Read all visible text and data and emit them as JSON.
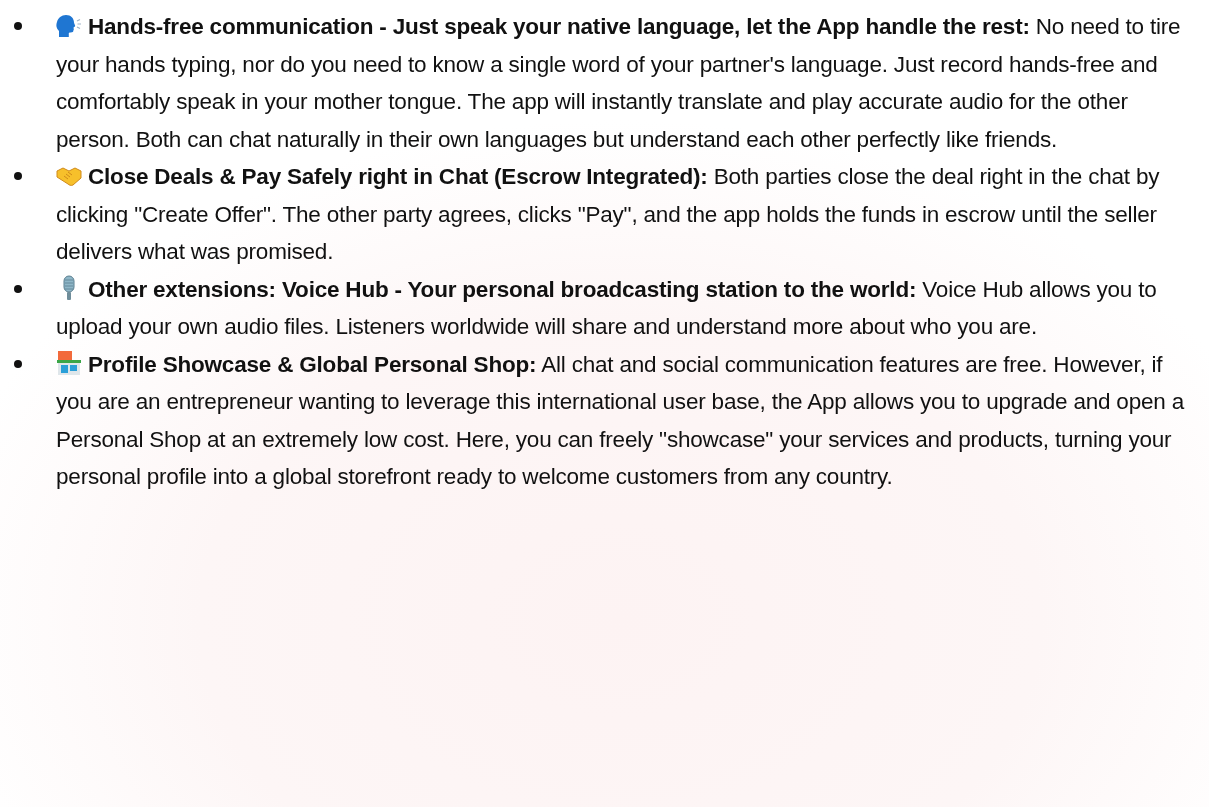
{
  "features": [
    {
      "kind": "speaking-head",
      "text": "**Hands-free communication - Just speak your native language, let the App handle the rest:** No need to tire your hands typing, nor do you need to know a single word of your partner's language. Just record hands-free and comfortably speak in your mother tongue. The app will instantly translate and play accurate audio for the other person. Both can chat naturally in their own languages but understand each other perfectly like friends."
    },
    {
      "kind": "handshake",
      "text": "**Close Deals & Pay Safely right in Chat (Escrow Integrated):** Both parties close the deal right in the chat by clicking \"Create Offer\". The other party agrees, clicks \"Pay\", and the app holds the funds in escrow until the seller delivers what was promised."
    },
    {
      "kind": "microphone",
      "text": "**Other extensions: Voice Hub - Your personal broadcasting station to the world:** Voice Hub allows you to upload your own audio files. Listeners worldwide will share and understand more about who you are."
    },
    {
      "kind": "store",
      "text": "**Profile Showcase & Global Personal Shop:** All chat and social communication features are free. However, if you are an entrepreneur wanting to leverage this international user base, the App allows you to upgrade and open a Personal Shop at an extremely low cost. Here, you can freely \"showcase\" your services and products, turning your personal profile into a global storefront ready to welcome customers from any country."
    }
  ]
}
